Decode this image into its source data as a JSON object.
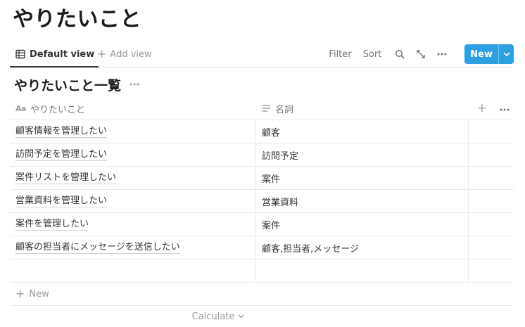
{
  "page": {
    "title": "やりたいこと"
  },
  "viewbar": {
    "active_tab": "Default view",
    "add_view": "Add view",
    "filter": "Filter",
    "sort": "Sort",
    "new_label": "New"
  },
  "database": {
    "title": "やりたいこと一覧",
    "columns": [
      {
        "label": "やりたいこと",
        "type_icon": "Aa"
      },
      {
        "label": "名詞"
      }
    ],
    "rows": [
      {
        "title": "顧客情報を管理したい",
        "noun": "顧客"
      },
      {
        "title": "訪問予定を管理したい",
        "noun": "訪問予定"
      },
      {
        "title": "案件リストを管理したい",
        "noun": "案件"
      },
      {
        "title": "営業資料を管理したい",
        "noun": "営業資料"
      },
      {
        "title": "案件を管理したい",
        "noun": "案件"
      },
      {
        "title": "顧客の担当者にメッセージを送信したい",
        "noun": "顧客,担当者,メッセージ"
      }
    ],
    "new_row_label": "New",
    "calculate_label": "Calculate"
  },
  "colors": {
    "accent": "#2e9fe0",
    "text": "#37352f",
    "muted": "#9b9a97",
    "border": "#e9e9e7"
  }
}
